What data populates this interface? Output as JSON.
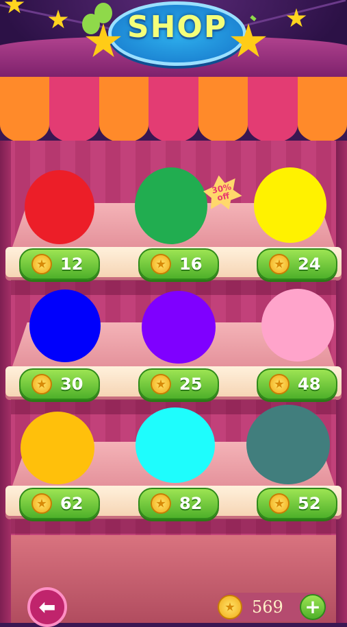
{
  "title": "SHOP",
  "badge": {
    "line1": "30%",
    "line2": "off"
  },
  "items": [
    {
      "color": "#ec1e28",
      "price": "12"
    },
    {
      "color": "#21ad50",
      "price": "16"
    },
    {
      "color": "#fff200",
      "price": "24"
    },
    {
      "color": "#0000fc",
      "price": "30"
    },
    {
      "color": "#7f00ff",
      "price": "25"
    },
    {
      "color": "#ffa4cb",
      "price": "48"
    },
    {
      "color": "#ffc00b",
      "price": "62"
    },
    {
      "color": "#1efdfd",
      "price": "82"
    },
    {
      "color": "#417e7d",
      "price": "52"
    }
  ],
  "balance": "569",
  "icons": {
    "back": "back-arrow-icon",
    "add": "plus-icon",
    "currency": "coin-icon"
  }
}
